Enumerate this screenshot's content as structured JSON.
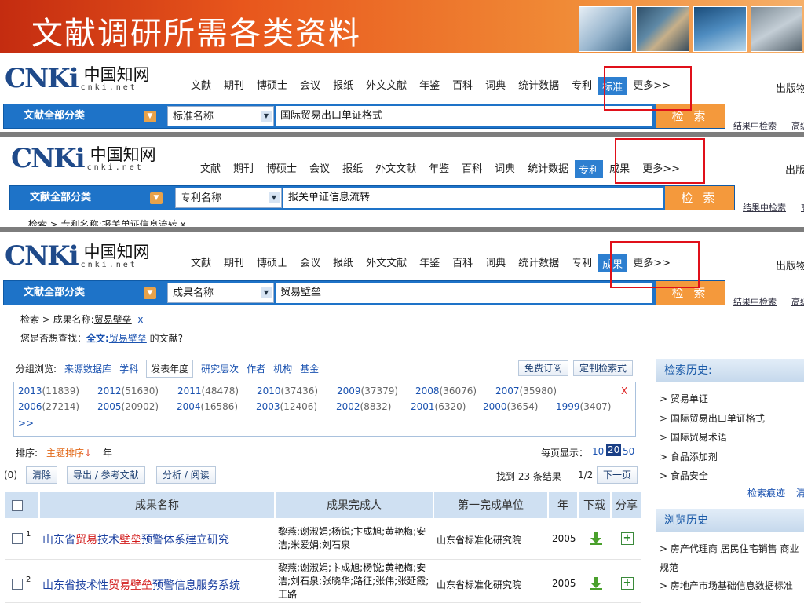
{
  "slide": {
    "title": "文献调研所需各类资料"
  },
  "logo": {
    "mark": "CNKi",
    "chinese": "中国知网",
    "domain": "cnki.net"
  },
  "nav_items_a": [
    "文献",
    "期刊",
    "博硕士",
    "会议",
    "报纸",
    "外文文献",
    "年鉴",
    "百科",
    "词典",
    "统计数据",
    "专利",
    "标准",
    "更多>>"
  ],
  "nav_items_b": [
    "文献",
    "期刊",
    "博硕士",
    "会议",
    "报纸",
    "外文文献",
    "年鉴",
    "百科",
    "词典",
    "统计数据",
    "专利",
    "成果",
    "更多>>"
  ],
  "nav_items_c": [
    "文献",
    "期刊",
    "博硕士",
    "会议",
    "报纸",
    "外文文献",
    "年鉴",
    "百科",
    "词典",
    "统计数据",
    "专利",
    "成果",
    "更多>>"
  ],
  "right_link": "出版物",
  "panel1": {
    "category": "文献全部分类",
    "field": "标准名称",
    "query": "国际贸易出口单证格式",
    "search_btn": "检 索",
    "link1": "结果中检索",
    "link2": "高级检索"
  },
  "panel2": {
    "category": "文献全部分类",
    "field": "专利名称",
    "query": "报关单证信息流转",
    "search_btn": "检 索",
    "link1": "结果中检索",
    "link2": "高级",
    "breadcrumb": "检索 > 专利名称:报关单证信息流转  x"
  },
  "panel3": {
    "category": "文献全部分类",
    "field": "成果名称",
    "query": "贸易壁垒",
    "search_btn": "检 索",
    "link1": "结果中检索",
    "link2": "高级",
    "breadcrumb_prefix": "检索 > 成果名称:",
    "breadcrumb_term": "贸易壁垒",
    "breadcrumb_close": "x",
    "suggest_prefix": "您是否想查找：",
    "suggest_label": "全文:",
    "suggest_term": "贸易壁垒",
    "suggest_suffix": " 的文献?"
  },
  "group_browse": {
    "label": "分组浏览:",
    "tabs": [
      "来源数据库",
      "学科",
      "发表年度",
      "研究层次",
      "作者",
      "机构",
      "基金"
    ],
    "active": "发表年度",
    "free_sub": "免费订阅",
    "custom": "定制检索式"
  },
  "years": [
    {
      "year": "2013",
      "count": "(11839)"
    },
    {
      "year": "2012",
      "count": "(51630)"
    },
    {
      "year": "2011",
      "count": "(48478)"
    },
    {
      "year": "2010",
      "count": "(37436)"
    },
    {
      "year": "2009",
      "count": "(37379)"
    },
    {
      "year": "2008",
      "count": "(36076)"
    },
    {
      "year": "2007",
      "count": "(35980)"
    },
    {
      "year": "2006",
      "count": "(27214)"
    },
    {
      "year": "2005",
      "count": "(20902)"
    },
    {
      "year": "2004",
      "count": "(16586)"
    },
    {
      "year": "2003",
      "count": "(12406)"
    },
    {
      "year": "2002",
      "count": "(8832)"
    },
    {
      "year": "2001",
      "count": "(6320)"
    },
    {
      "year": "2000",
      "count": "(3654)"
    },
    {
      "year": "1999",
      "count": "(3407)"
    }
  ],
  "years_more": ">>",
  "years_close": "X",
  "sort": {
    "label": "排序:",
    "topic": "主题排序",
    "year": "年",
    "per_page": "每页显示：",
    "opts": [
      "10",
      "20",
      "50"
    ],
    "active": "20"
  },
  "toolbar": {
    "count0": "(0)",
    "clear": "清除",
    "export": "导出 / 参考文献",
    "analyze": "分析 / 阅读",
    "found": "找到 23 条结果",
    "page": "1/2",
    "next": "下一页"
  },
  "table": {
    "headers": [
      "成果名称",
      "成果完成人",
      "第一完成单位",
      "年",
      "下载",
      "分享"
    ],
    "rows": [
      {
        "num": "1",
        "title_a": "山东省",
        "title_h1": "贸易",
        "title_b": "技术",
        "title_h2": "壁垒",
        "title_c": "预警体系建立研究",
        "authors": "黎燕;谢淑娟;杨锐;卞成旭;黄艳梅;安洁;米爱娟;刘石泉",
        "unit": "山东省标准化研究院",
        "year": "2005"
      },
      {
        "num": "2",
        "title_a": "山东省技术性",
        "title_h1": "贸易",
        "title_b": "",
        "title_h2": "壁垒",
        "title_c": "预警信息服务系统",
        "authors": "黎燕;谢淑娟;卞成旭;杨锐;黄艳梅;安洁;刘石泉;张晓华;路征;张伟;张延霞;王路",
        "unit": "山东省标准化研究院",
        "year": "2005"
      }
    ]
  },
  "sidebar": {
    "history_title": "检索历史:",
    "history": [
      "贸易单证",
      "国际贸易出口单证格式",
      "国际贸易术语",
      "食品添加剂",
      "食品安全"
    ],
    "trace": "检索痕迹",
    "clear": "清",
    "browse_title": "浏览历史",
    "browse": [
      "房产代理商 居民住宅销售 商业",
      "规范",
      "房地产市场基础信息数据标准"
    ]
  }
}
